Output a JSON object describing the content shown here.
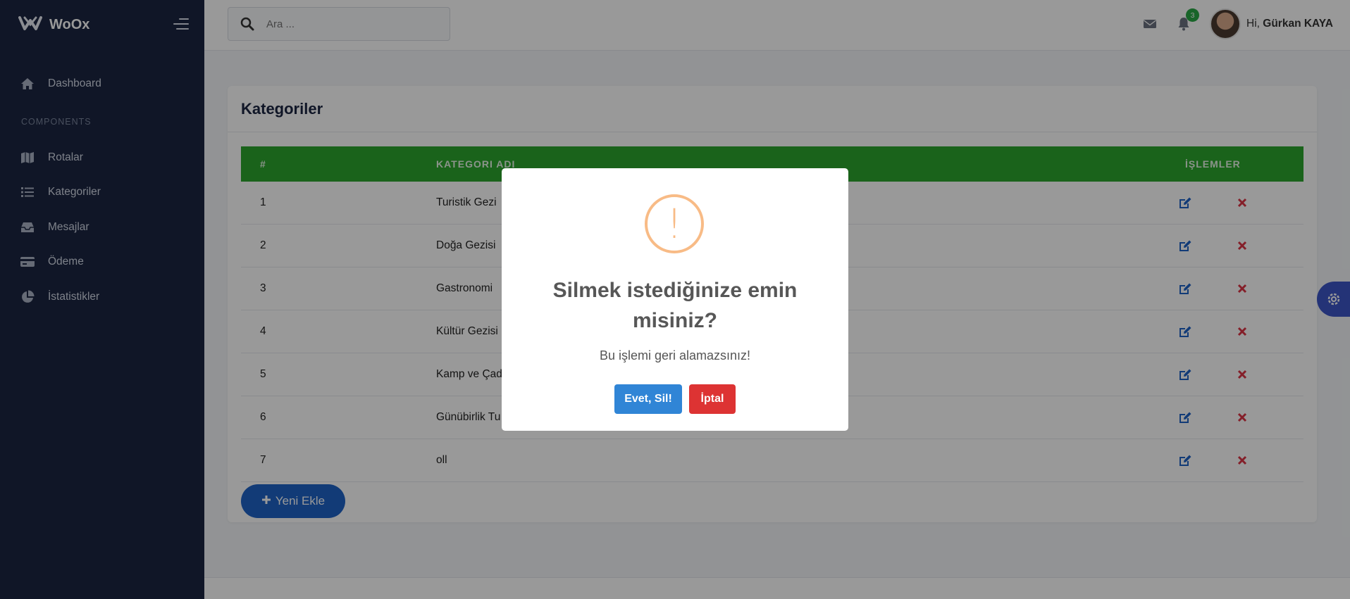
{
  "brand": {
    "name": "WoOx"
  },
  "sidebar": {
    "section_label": "COMPONENTS",
    "items": [
      {
        "label": "Dashboard",
        "icon": "home-icon"
      },
      {
        "label": "Rotalar",
        "icon": "map-icon"
      },
      {
        "label": "Kategoriler",
        "icon": "list-icon"
      },
      {
        "label": "Mesajlar",
        "icon": "inbox-icon"
      },
      {
        "label": "Ödeme",
        "icon": "credit-card-icon"
      },
      {
        "label": "İstatistikler",
        "icon": "pie-chart-icon"
      }
    ]
  },
  "topbar": {
    "search_placeholder": "Ara ...",
    "notification_count": "3",
    "greeting": "Hi,",
    "user_name": "Gürkan KAYA"
  },
  "page": {
    "title": "Kategoriler",
    "table": {
      "headers": [
        "#",
        "KATEGORI ADI",
        "İŞLEMLER"
      ],
      "rows": [
        {
          "id": "1",
          "name": "Turistik Gezi"
        },
        {
          "id": "2",
          "name": "Doğa Gezisi"
        },
        {
          "id": "3",
          "name": "Gastronomi"
        },
        {
          "id": "4",
          "name": "Kültür Gezisi"
        },
        {
          "id": "5",
          "name": "Kamp ve Çad"
        },
        {
          "id": "6",
          "name": "Günübirlik Tu"
        },
        {
          "id": "7",
          "name": "oll"
        }
      ]
    },
    "add_button": "Yeni Ekle"
  },
  "modal": {
    "icon": "!",
    "title": "Silmek istediğinize emin misiniz?",
    "text": "Bu işlemi geri alamazsınız!",
    "confirm_label": "Evet, Sil!",
    "cancel_label": "İptal"
  },
  "colors": {
    "sidebar_bg": "#1b2541",
    "table_header": "#2ca52e",
    "primary": "#1e63c7",
    "confirm": "#3085d6",
    "cancel": "#dd3333",
    "warning": "#f8bb86"
  }
}
